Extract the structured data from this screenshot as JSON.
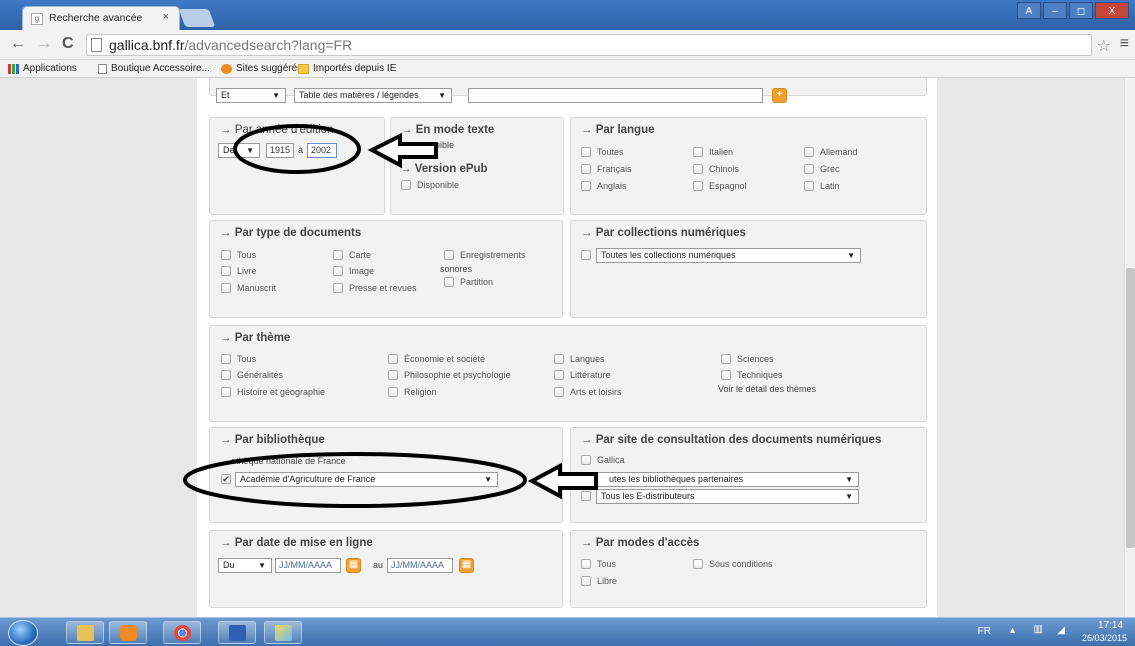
{
  "browser": {
    "tab_title": "Recherche avancée",
    "tab_close": "×",
    "url_host": "gallica.bnf.fr",
    "url_path": "/advancedsearch?lang=FR",
    "back": "←",
    "forward": "→",
    "reload": "C",
    "star": "☆",
    "menu": "≡",
    "window_buttons": {
      "a": "A",
      "minimize": "–",
      "maximize": "◻",
      "close": "X"
    }
  },
  "bookmarks": [
    {
      "label": "Applications"
    },
    {
      "label": "Boutique Accessoire..."
    },
    {
      "label": "Sites suggérés"
    },
    {
      "label": "Importés depuis IE"
    }
  ],
  "top_row": {
    "op": "Et",
    "field": "Table des matières / légendes",
    "add": "+"
  },
  "annee": {
    "title": "Par année d'édition",
    "mode": "De",
    "from": "1915",
    "sep": "à",
    "to": "2002"
  },
  "texte": {
    "title": "En mode texte",
    "partial_label": "nible",
    "epub_title": "Version ePub",
    "epub_option": "Disponible"
  },
  "langue": {
    "title": "Par langue",
    "options": [
      "Toutes",
      "Italien",
      "Allemand",
      "Français",
      "Chinois",
      "Grec",
      "Anglais",
      "Espagnol",
      "Latin"
    ]
  },
  "type_docs": {
    "title": "Par type de documents",
    "options": [
      "Tous",
      "Carte",
      "Enregistrements",
      "Livre",
      "Image",
      "sonores",
      "Partition",
      "Manuscrit",
      "Presse et revues"
    ]
  },
  "collections": {
    "title": "Par collections numériques",
    "select": "Toutes les collections numériques"
  },
  "theme": {
    "title": "Par thème",
    "options": [
      "Tous",
      "Économie et société",
      "Langues",
      "Sciences",
      "Généralités",
      "Philosophie et psychologie",
      "Littérature",
      "Techniques",
      "Histoire et géographie",
      "Religion",
      "Arts et loisirs"
    ],
    "detail_link": "Voir le détail des thèmes"
  },
  "bibliotheque": {
    "title": "Par bibliothèque",
    "option1": "Bibliothèque nationale de France",
    "option1_visible": "othèque nationale de France",
    "select": "Académie d'Agriculture de France",
    "checked_mark": "✔"
  },
  "site": {
    "title": "Par site de consultation des documents numériques",
    "gallica": "Gallica",
    "partenaires": "Toutes les bibliothèques partenaires",
    "partenaires_visible": "utes les bibliothèques partenaires",
    "distributeurs": "Tous les E-distributeurs"
  },
  "date_ligne": {
    "title": "Par date de mise en ligne",
    "mode": "Du",
    "from_placeholder": "JJ/MM/AAAA",
    "sep": "au",
    "to_placeholder": "JJ/MM/AAAA"
  },
  "acces": {
    "title": "Par modes d'accès",
    "options": [
      "Tous",
      "Sous conditions",
      "Libre"
    ]
  },
  "arrow_prefix": "→",
  "taskbar": {
    "lang": "FR",
    "time": "17:14",
    "date": "26/03/2015"
  },
  "colors": {
    "orange": "#f0a030",
    "annotation": "#000000"
  }
}
